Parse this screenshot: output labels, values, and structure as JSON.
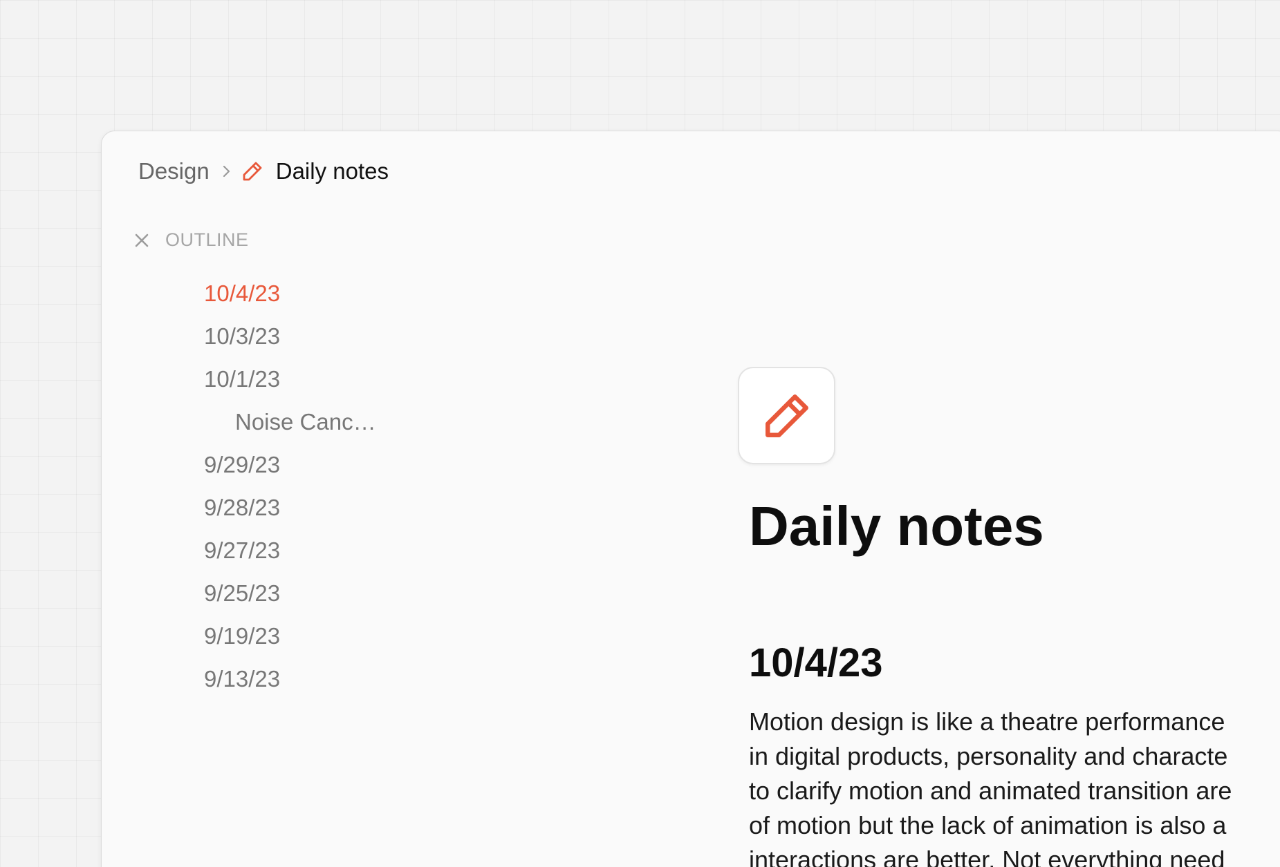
{
  "colors": {
    "accent": "#e8583a",
    "background": "#f3f3f3",
    "window": "#fafafa"
  },
  "breadcrumb": {
    "parent": "Design",
    "separator_icon": "chevron-right-icon",
    "page_icon": "pencil-icon",
    "current": "Daily notes"
  },
  "outline": {
    "close_icon": "close-icon",
    "title": "OUTLINE",
    "items": [
      {
        "label": "10/4/23",
        "active": true
      },
      {
        "label": "10/3/23"
      },
      {
        "label": "10/1/23"
      },
      {
        "label": "Noise Canc…",
        "sub": true
      },
      {
        "label": "9/29/23"
      },
      {
        "label": "9/28/23"
      },
      {
        "label": "9/27/23"
      },
      {
        "label": "9/25/23"
      },
      {
        "label": "9/19/23"
      },
      {
        "label": "9/13/23"
      }
    ]
  },
  "page": {
    "icon": "pencil-icon",
    "title": "Daily notes",
    "section_heading": "10/4/23",
    "body_lines": [
      "Motion design is like a theatre performance",
      "in digital products, personality and characte",
      "to clarify motion and animated transition are",
      "of motion but the lack of animation is also a",
      "interactions are better. Not everything need"
    ]
  }
}
